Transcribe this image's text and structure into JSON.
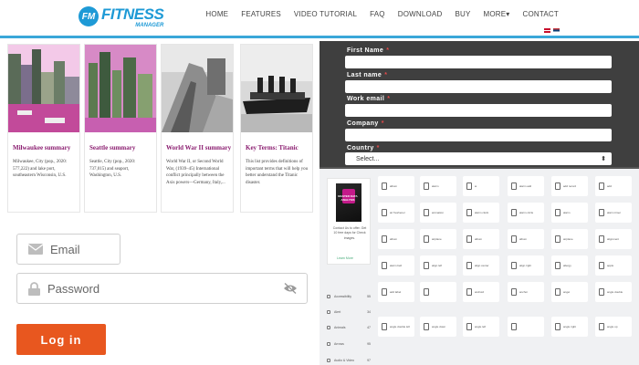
{
  "header": {
    "logo_badge": "FM",
    "logo_name": "FITNESS",
    "logo_sub": "MANAGER",
    "nav": [
      "HOME",
      "FEATURES",
      "VIDEO TUTORIAL",
      "FAQ",
      "DOWNLOAD",
      "BUY",
      "MORE▾",
      "CONTACT"
    ]
  },
  "cards": [
    {
      "title": "Milwaukee summary",
      "text": "Milwaukee, City (pop., 2020: 577,222) and lake port, southeastern Wisconsin, U.S."
    },
    {
      "title": "Seattle summary",
      "text": "Seattle, City (pop., 2020: 737,015) and seaport, Washington, U.S."
    },
    {
      "title": "World War II summary",
      "text": "World War II, or Second World War, (1939–45) International conflict principally between the Axis powers—Germany, Italy,..."
    },
    {
      "title": "Key Terms: Titanic",
      "text": "This list provides definitions of important terms that will help you better understand the Titanic disaster."
    }
  ],
  "login": {
    "email_placeholder": "Email",
    "password_placeholder": "Password",
    "login_label": "Log in"
  },
  "signup_form": {
    "first_name": "First Name",
    "last_name": "Last name",
    "work_email": "Work email",
    "company": "Company",
    "country": "Country",
    "required_mark": "*",
    "country_select": "Select...",
    "select_arrow": "⬍"
  },
  "directory": {
    "ad_caption": "MASTER DATA ANALYSIS",
    "ad_text": "Contact Us to offer. Get 10 free days for Check images.",
    "ad_link": "Learn More",
    "categories": [
      {
        "label": "Accessibility",
        "count": "55"
      },
      {
        "label": "Alert",
        "count": "34"
      },
      {
        "label": "Animals",
        "count": "47"
      },
      {
        "label": "Arrows",
        "count": "95"
      },
      {
        "label": "Audio & Video",
        "count": "97"
      }
    ],
    "tiles": [
      "album",
      "alarm",
      "ai",
      "alarm add",
      "add record",
      "add",
      "air freshener",
      "animation",
      "alarm clock",
      "alarm circle",
      "alarm",
      "alarm timer",
      "album",
      "airplane",
      "album",
      "album",
      "airplane",
      "alignment",
      "alarm bell",
      "align left",
      "align center",
      "align right",
      "allergy",
      "apple",
      "add label",
      "",
      "android",
      "anchor",
      "angel",
      "angle double",
      "angle double left",
      "angle down",
      "angle left",
      "",
      "angle right",
      "angle up",
      "animal",
      "anchor",
      "app store",
      "apple",
      "archive",
      "arrow"
    ]
  }
}
